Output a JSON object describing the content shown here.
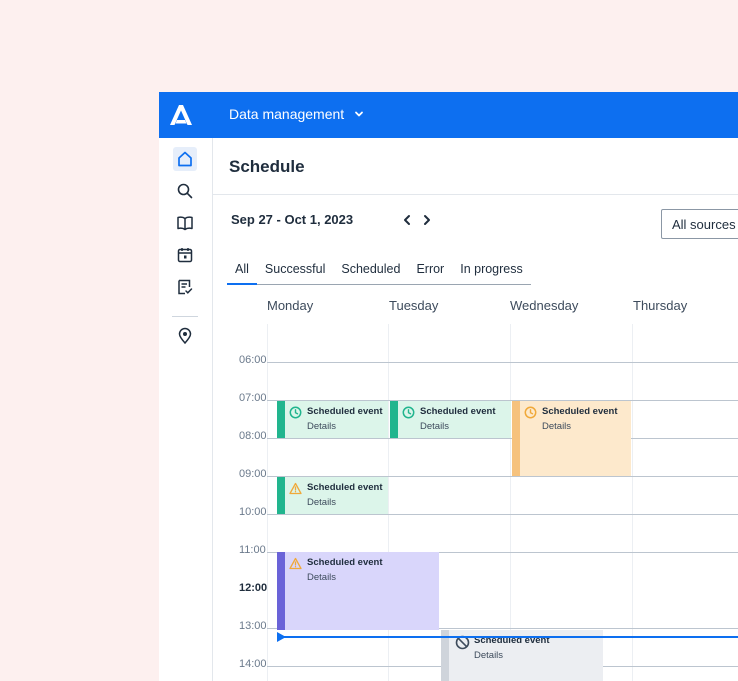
{
  "topbar": {
    "logo_icon": "brand-logo-icon",
    "workspace_label": "Data management",
    "workspace_icon": "chevron-down-icon",
    "color": "#0d6ff0"
  },
  "sidebar": {
    "items": [
      {
        "icon": "home-icon",
        "active": true
      },
      {
        "icon": "search-icon"
      },
      {
        "icon": "book-icon"
      },
      {
        "icon": "calendar-icon"
      },
      {
        "icon": "checklist-icon"
      },
      {
        "icon": "location-pin-icon"
      }
    ]
  },
  "main": {
    "title": "Schedule",
    "date_range": "Sep 27 - Oct 1, 2023",
    "source_filter": "All sources",
    "tabs": [
      {
        "label": "All",
        "active": true
      },
      {
        "label": "Successful"
      },
      {
        "label": "Scheduled"
      },
      {
        "label": "Error"
      },
      {
        "label": "In progress"
      }
    ],
    "days": [
      "Monday",
      "Tuesday",
      "Wednesday",
      "Thursday"
    ],
    "times": [
      "06:00",
      "07:00",
      "08:00",
      "09:00",
      "10:00",
      "11:00",
      "12:00",
      "13:00",
      "14:00"
    ],
    "current_time": "12:00",
    "events": [
      {
        "title": "Scheduled event",
        "detail": "Details",
        "icon": "clock-icon",
        "status": "scheduled",
        "color": "#21b58e"
      },
      {
        "title": "Scheduled event",
        "detail": "Details",
        "icon": "clock-icon",
        "status": "scheduled",
        "color": "#21b58e"
      },
      {
        "title": "Scheduled event",
        "detail": "Details",
        "icon": "clock-icon",
        "status": "pending",
        "color": "#f6c27d"
      },
      {
        "title": "Scheduled event",
        "detail": "Details",
        "icon": "warning-icon",
        "status": "warning",
        "color": "#21b58e"
      },
      {
        "title": "Scheduled event",
        "detail": "Details",
        "icon": "warning-icon",
        "status": "in-progress",
        "color": "#6a63d8"
      },
      {
        "title": "Scheduled event",
        "detail": "Details",
        "icon": "blocked-icon",
        "status": "cancelled",
        "color": "#cfd4db"
      }
    ]
  }
}
